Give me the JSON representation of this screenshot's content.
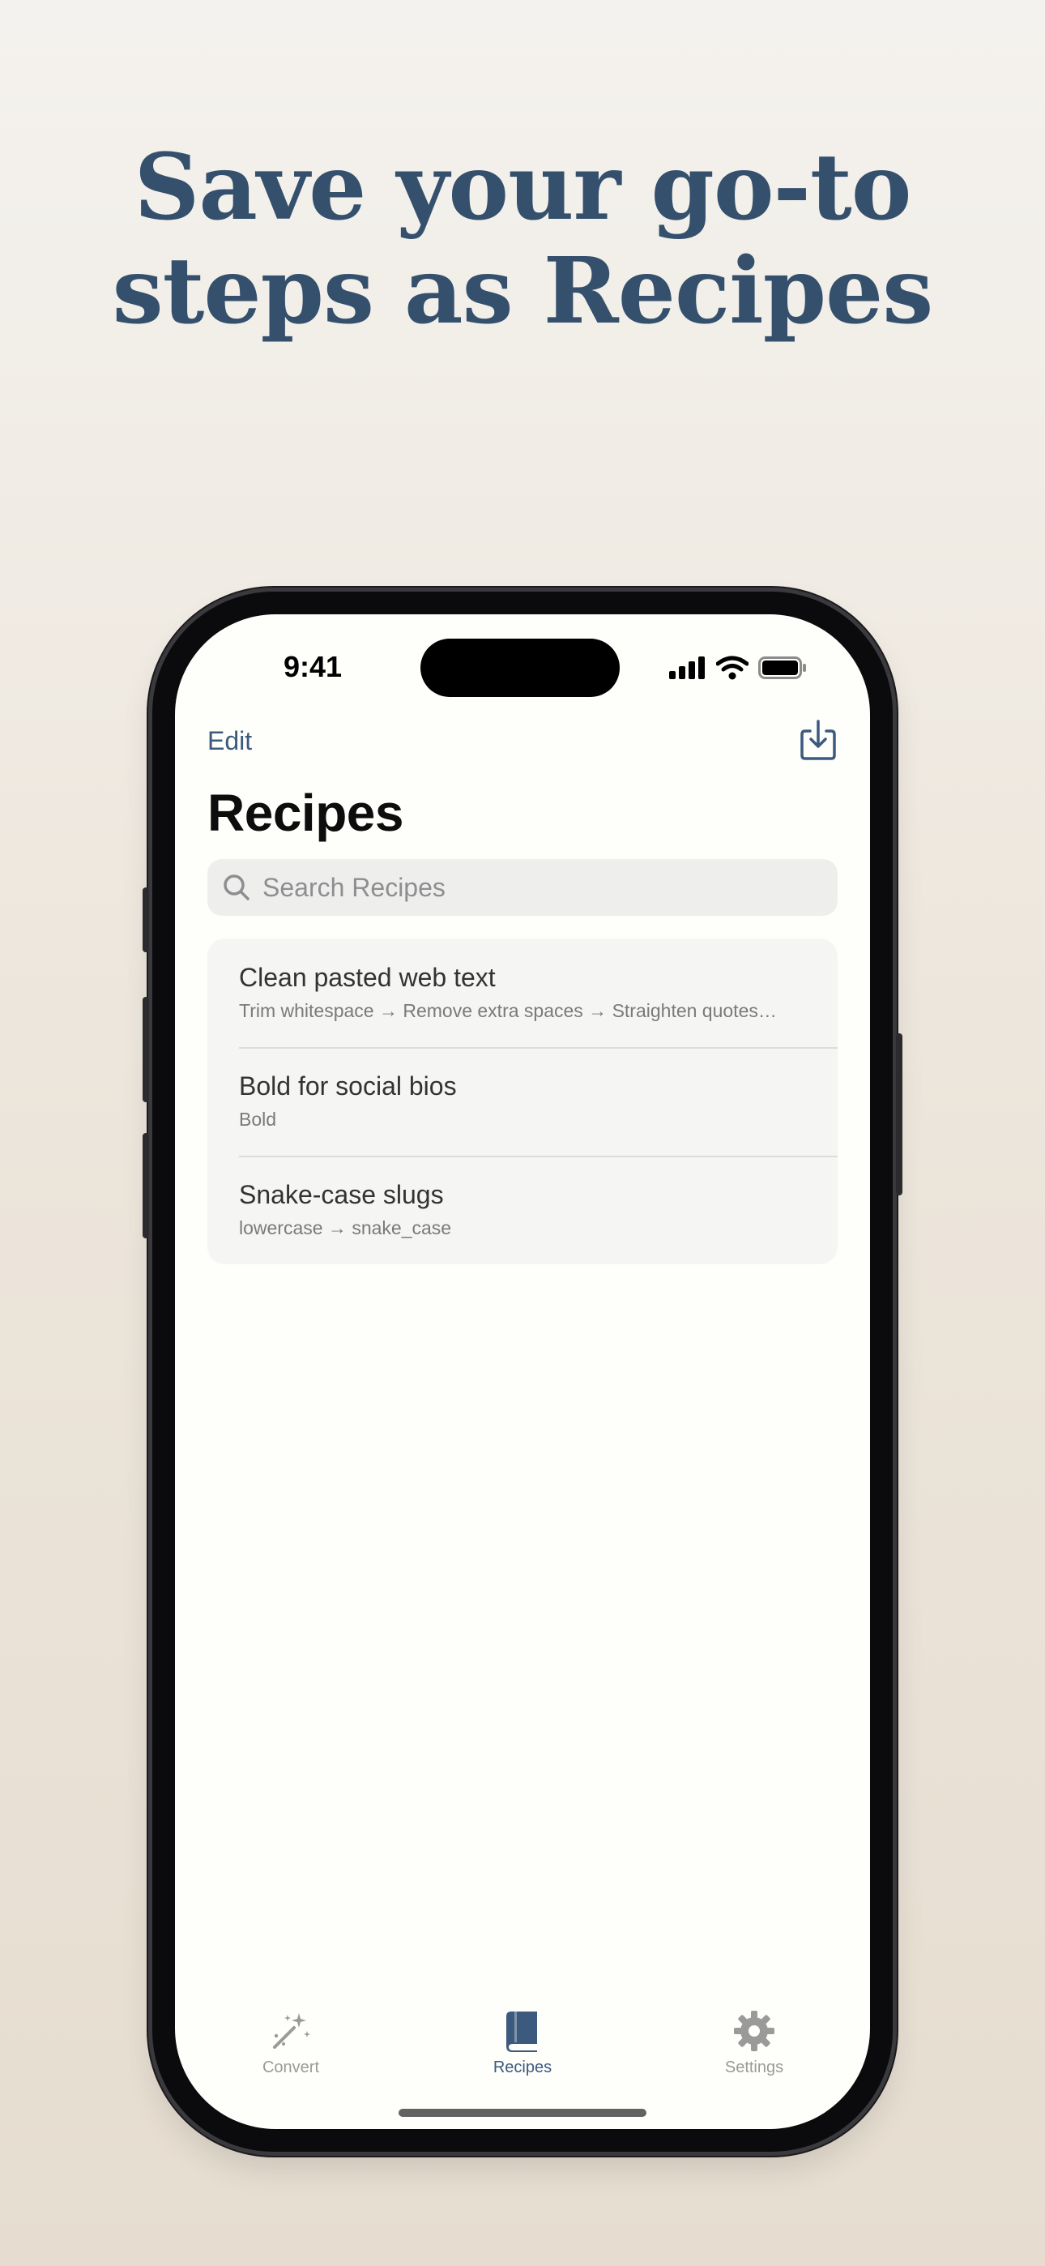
{
  "headline": {
    "line1": "Save your go-to",
    "line2": "steps as Recipes"
  },
  "status_bar": {
    "time": "9:41"
  },
  "nav": {
    "edit_label": "Edit",
    "import_icon": "tray-arrow-down-icon"
  },
  "page": {
    "title": "Recipes"
  },
  "search": {
    "placeholder": "Search Recipes"
  },
  "recipes": [
    {
      "title": "Clean pasted web text",
      "steps": "Trim whitespace → Remove extra spaces → Straighten quotes…"
    },
    {
      "title": "Bold for social bios",
      "steps": "Bold"
    },
    {
      "title": "Snake-case slugs",
      "steps": "lowercase → snake_case"
    }
  ],
  "tabs": [
    {
      "label": "Convert",
      "icon": "magic-wand-icon",
      "selected": false
    },
    {
      "label": "Recipes",
      "icon": "book-icon",
      "selected": true
    },
    {
      "label": "Settings",
      "icon": "gear-icon",
      "selected": false
    }
  ],
  "colors": {
    "accent": "#3c5a7e",
    "headline": "#35506d",
    "inactive_tab": "#9a9a9a"
  }
}
